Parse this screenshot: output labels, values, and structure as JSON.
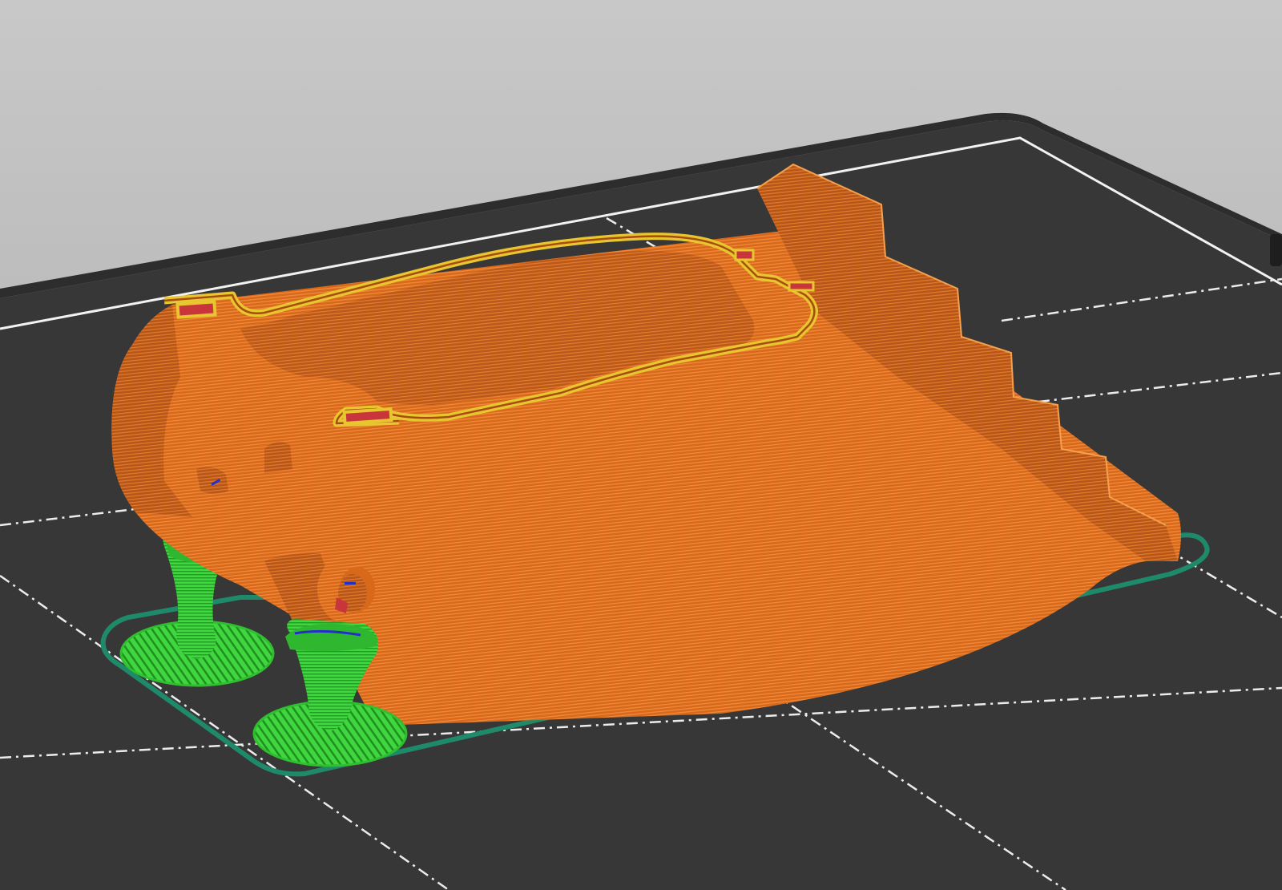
{
  "app": {
    "view": "slicer-preview-3d",
    "colors": {
      "background_top": "#c6c6c6",
      "background_bottom": "#a8a8a8",
      "bed": "#373737",
      "bed_edge": "#2a2a2a",
      "grid_line": "#f2f2f2",
      "perimeter": "#d9691a",
      "perimeter_dark": "#a84d10",
      "perimeter_line": "#f08a3a",
      "external_perimeter": "#e8c630",
      "top_solid": "#c8353a",
      "support": "#3fd63f",
      "support_dark": "#1f8f1f",
      "skirt": "#1f8a6a",
      "wipe": "#2230c8"
    }
  },
  "scene": {
    "objects": [
      {
        "name": "printed-part",
        "feature": "perimeter"
      },
      {
        "name": "support-pillar-left",
        "feature": "support"
      },
      {
        "name": "support-pillar-right",
        "feature": "support"
      },
      {
        "name": "skirt-loop",
        "feature": "skirt"
      }
    ]
  }
}
